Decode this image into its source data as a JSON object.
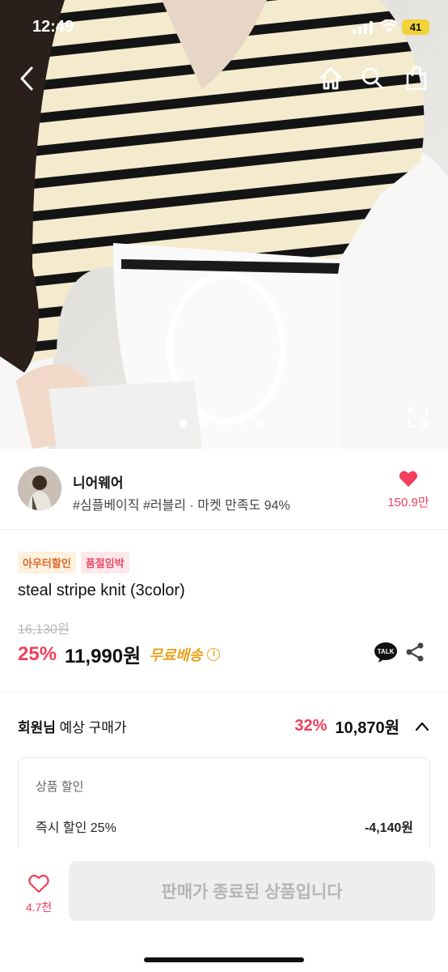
{
  "status_bar": {
    "time": "12:49",
    "battery": "41"
  },
  "shop": {
    "name": "니어웨어",
    "tags": "#심플베이직 #러블리 · 마켓 만족도 94%",
    "like_count": "150.9만"
  },
  "product": {
    "badges": [
      "아우터할인",
      "품절임박"
    ],
    "title": "steal stripe knit (3color)",
    "original_price": "16,130원",
    "discount_percent": "25%",
    "price": "11,990원",
    "shipping": "무료배송",
    "talk_label": "TALK"
  },
  "member_price": {
    "label_bold": "회원님",
    "label_rest": " 예상 구매가",
    "percent": "32%",
    "price": "10,870원"
  },
  "discount_detail": {
    "title": "상품 할인",
    "item_label": "즉시 할인 25%",
    "item_value": "-4,140원"
  },
  "bottom_bar": {
    "wish_count": "4.7천",
    "buy_label": "판매가 종료된 상품입니다"
  },
  "carousel": {
    "total": 5,
    "active_index": 0
  },
  "colors": {
    "accent": "#f0405c",
    "shipping": "#e8a21a"
  }
}
